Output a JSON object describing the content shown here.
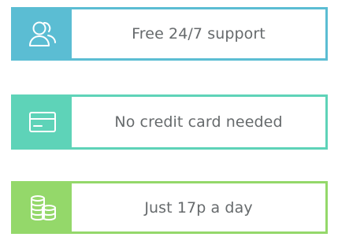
{
  "features": [
    {
      "label": "Free 24/7 support",
      "icon": "support-person-icon",
      "color": "#5bbdd3"
    },
    {
      "label": "No credit card needed",
      "icon": "credit-card-icon",
      "color": "#5ed3b8"
    },
    {
      "label": "Just 17p a day",
      "icon": "coins-stack-icon",
      "color": "#94d86a"
    }
  ]
}
